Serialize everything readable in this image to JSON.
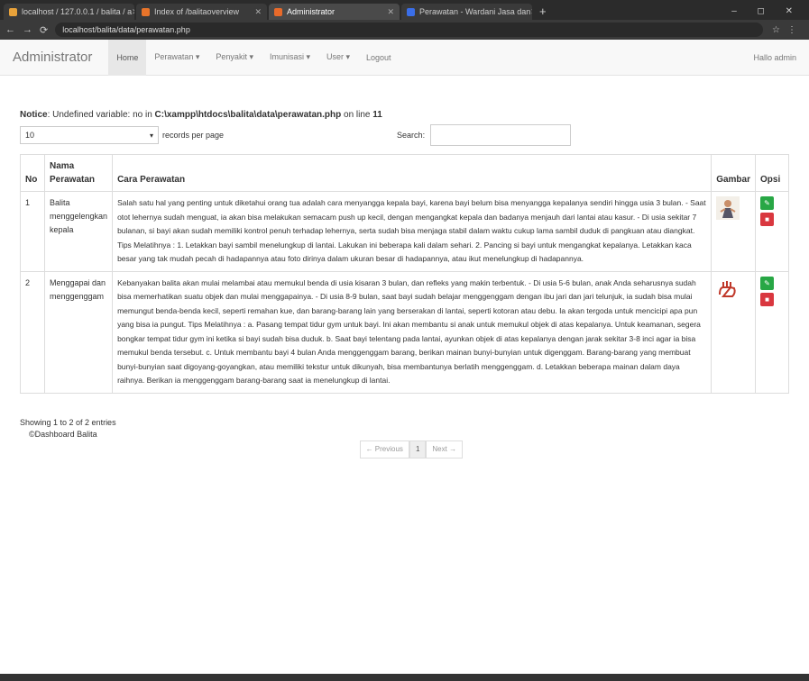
{
  "browser": {
    "tabs": [
      {
        "title": "localhost / 127.0.0.1 / balita / a",
        "color": "#e8a23a",
        "active": false
      },
      {
        "title": "Index of /balitaoverview",
        "color": "#e8742a",
        "active": false
      },
      {
        "title": "Administrator",
        "color": "#e86a2a",
        "active": true
      },
      {
        "title": "Perawatan - Wardani Jasa dan",
        "color": "#3a6ee8",
        "active": false
      }
    ],
    "new_tab": "+",
    "window_controls": "– ◻ ✕",
    "url": "localhost/balita/data/perawatan.php"
  },
  "navbar": {
    "brand": "Administrator",
    "items": [
      "Home",
      "Perawatan ▾",
      "Penyakit ▾",
      "Imunisasi ▾",
      "User ▾",
      "Logout"
    ],
    "greeting": "Hallo admin"
  },
  "notice": {
    "label": "Notice",
    "text": ": Undefined variable: no in ",
    "path": "C:\\xampp\\htdocs\\balita\\data\\perawatan.php",
    "line_text": " on line ",
    "line": "11"
  },
  "length": {
    "value": "10",
    "label": "records per page"
  },
  "search": {
    "label": "Search:"
  },
  "table": {
    "headers": {
      "no": "No",
      "nama": "Nama Perawatan",
      "cara": "Cara Perawatan",
      "gambar": "Gambar",
      "opsi": "Opsi"
    },
    "rows": [
      {
        "no": "1",
        "nama": "Balita menggelengkan kepala",
        "cara": "Salah satu hal yang penting untuk diketahui orang tua adalah cara menyangga kepala bayi, karena bayi belum bisa menyangga kepalanya sendiri hingga usia 3 bulan. - Saat otot lehernya sudah menguat, ia akan bisa melakukan semacam push up kecil, dengan mengangkat kepala dan badanya menjauh dari lantai atau kasur. - Di usia sekitar 7 bulanan, si bayi akan sudah memiliki kontrol penuh terhadap lehernya, serta sudah bisa menjaga stabil dalam waktu cukup lama sambil duduk di pangkuan atau diangkat. Tips Melatihnya : 1. Letakkan bayi sambil menelungkup di lantai. Lakukan ini beberapa kali dalam sehari. 2. Pancing si bayi untuk mengangkat kepalanya. Letakkan kaca besar yang tak mudah pecah di hadapannya atau foto dirinya dalam ukuran besar di hadapannya, atau ikut menelungkup di hadapannya."
      },
      {
        "no": "2",
        "nama": "Menggapai dan menggenggam",
        "cara": "Kebanyakan balita akan mulai melambai atau memukul benda di usia kisaran 3 bulan, dan refleks yang makin terbentuk. - Di usia 5-6 bulan, anak Anda seharusnya sudah bisa memerhatikan suatu objek dan mulai menggapainya. - Di usia 8-9 bulan, saat bayi sudah belajar menggenggam dengan ibu jari dan jari telunjuk, ia sudah bisa mulai memungut benda-benda kecil, seperti remahan kue, dan barang-barang lain yang berserakan di lantai, seperti kotoran atau debu. Ia akan tergoda untuk mencicipi apa pun yang bisa ia pungut. Tips Melatihnya : a. Pasang tempat tidur gym untuk bayi. Ini akan membantu si anak untuk memukul objek di atas kepalanya. Untuk keamanan, segera bongkar tempat tidur gym ini ketika si bayi sudah bisa duduk. b. Saat bayi telentang pada lantai, ayunkan objek di atas kepalanya dengan jarak sekitar 3-8 inci agar ia bisa memukul benda tersebut. c. Untuk membantu bayi 4 bulan Anda menggenggam barang, berikan mainan bunyi-bunyian untuk digenggam. Barang-barang yang membuat bunyi-bunyian saat digoyang-goyangkan, atau memiliki tekstur untuk dikunyah, bisa membantunya berlatih menggenggam. d. Letakkan beberapa mainan dalam daya raihnya. Berikan ia menggenggam barang-barang saat ia menelungkup di lantai."
      }
    ]
  },
  "footer": {
    "showing": "Showing 1 to 2 of 2 entries",
    "dashboard": "©Dashboard Balita"
  },
  "pagination": {
    "prev": "← Previous",
    "page": "1",
    "next": "Next →"
  },
  "colors": {
    "edit": "#28a745",
    "delete": "#d9373f",
    "navbar_bg": "#f8f8f8"
  },
  "icons": {
    "edit": "pencil-icon",
    "delete": "trash-icon"
  }
}
